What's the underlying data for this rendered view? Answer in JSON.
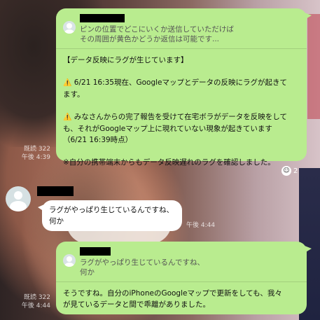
{
  "messages": {
    "top": {
      "reply_text_1": "ピンの位置でどこにいくか送信していただけば",
      "reply_text_2": "その周囲が黄色かどうか返信は可能です...",
      "header": "【データ反映にラグが生じています】",
      "warn_icon": "⚠️",
      "line1a": "6/21 16:35現在、Googleマップとデータの反映にラグが起きて",
      "line1b": "ます。",
      "line2a": "みなさんからの完了報告を受けて在宅ボラがデータを反映をして",
      "line2b": "も、それがGoogleマップ上に現れていない現象が起きています",
      "line2c": "（6/21 16:39時点）",
      "line3": "※自分の携帯端末からもデータ反映遅れのラグを確認しました。",
      "read": "既読 322",
      "time": "午後 4:39"
    },
    "reaction": {
      "icon": "reaction-icon",
      "count": "2"
    },
    "incoming": {
      "line1": "ラグがやっぱり生じているんですね、",
      "line2": "何か",
      "time": "午後 4:44"
    },
    "bottom": {
      "reply_text_1": "ラグがやっぱり生じているんですね、",
      "reply_text_2": "何か",
      "line1": "そうですね。自分のiPhoneのGoogleマップで更新をしても、我々",
      "line2": "が見ているデータと間で乖離がありました。",
      "read": "既読 322",
      "time": "午後 4:44"
    }
  },
  "colors": {
    "outgoing_bubble": "#b9ec8f",
    "incoming_bubble": "#ffffff",
    "warning": "#e8a300"
  }
}
